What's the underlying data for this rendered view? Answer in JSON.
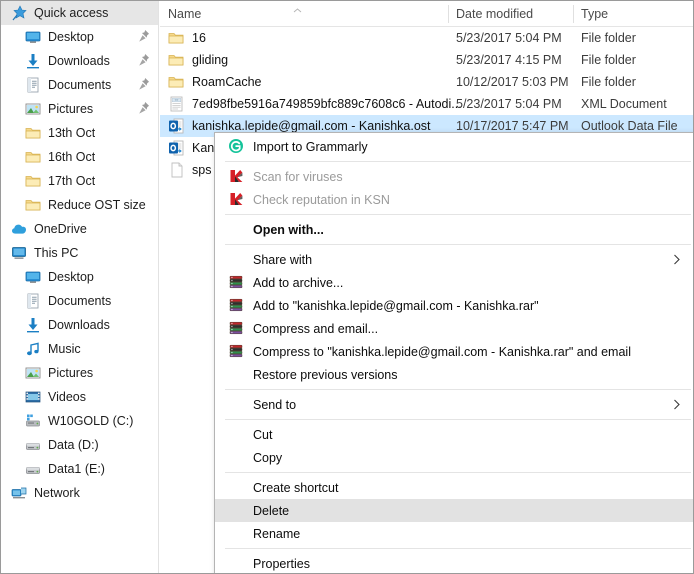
{
  "nav_pane": {
    "items": [
      {
        "label": "Quick access",
        "icon": "pin-star-icon",
        "level": 0,
        "selected": true,
        "pinned": false
      },
      {
        "label": "Desktop",
        "icon": "desktop-icon",
        "level": 1,
        "selected": false,
        "pinned": true
      },
      {
        "label": "Downloads",
        "icon": "downloads-icon",
        "level": 1,
        "selected": false,
        "pinned": true
      },
      {
        "label": "Documents",
        "icon": "documents-icon",
        "level": 1,
        "selected": false,
        "pinned": true
      },
      {
        "label": "Pictures",
        "icon": "pictures-icon",
        "level": 1,
        "selected": false,
        "pinned": true
      },
      {
        "label": "13th Oct",
        "icon": "folder-icon",
        "level": 1,
        "selected": false,
        "pinned": false
      },
      {
        "label": "16th Oct",
        "icon": "folder-icon",
        "level": 1,
        "selected": false,
        "pinned": false
      },
      {
        "label": "17th Oct",
        "icon": "folder-icon",
        "level": 1,
        "selected": false,
        "pinned": false
      },
      {
        "label": "Reduce OST size",
        "icon": "folder-icon",
        "level": 1,
        "selected": false,
        "pinned": false
      },
      {
        "label": "OneDrive",
        "icon": "onedrive-icon",
        "level": 0,
        "selected": false,
        "pinned": false
      },
      {
        "label": "This PC",
        "icon": "this-pc-icon",
        "level": 0,
        "selected": false,
        "pinned": false
      },
      {
        "label": "Desktop",
        "icon": "desktop-icon",
        "level": 1,
        "selected": false,
        "pinned": false
      },
      {
        "label": "Documents",
        "icon": "documents-icon",
        "level": 1,
        "selected": false,
        "pinned": false
      },
      {
        "label": "Downloads",
        "icon": "downloads-icon",
        "level": 1,
        "selected": false,
        "pinned": false
      },
      {
        "label": "Music",
        "icon": "music-icon",
        "level": 1,
        "selected": false,
        "pinned": false
      },
      {
        "label": "Pictures",
        "icon": "pictures-icon",
        "level": 1,
        "selected": false,
        "pinned": false
      },
      {
        "label": "Videos",
        "icon": "videos-icon",
        "level": 1,
        "selected": false,
        "pinned": false
      },
      {
        "label": "W10GOLD (C:)",
        "icon": "system-drive-icon",
        "level": 1,
        "selected": false,
        "pinned": false
      },
      {
        "label": "Data (D:)",
        "icon": "drive-icon",
        "level": 1,
        "selected": false,
        "pinned": false
      },
      {
        "label": "Data1 (E:)",
        "icon": "drive-icon",
        "level": 1,
        "selected": false,
        "pinned": false
      },
      {
        "label": "Network",
        "icon": "network-icon",
        "level": 0,
        "selected": false,
        "pinned": false
      }
    ]
  },
  "file_list": {
    "columns": [
      {
        "key": "name",
        "label": "Name",
        "sorted": true,
        "sort_direction": "ascending"
      },
      {
        "key": "date",
        "label": "Date modified",
        "sorted": false,
        "sort_direction": ""
      },
      {
        "key": "type",
        "label": "Type",
        "sorted": false,
        "sort_direction": ""
      }
    ],
    "rows": [
      {
        "name": "16",
        "date": "5/23/2017 5:04 PM",
        "type": "File folder",
        "icon": "folder-icon",
        "selected": false
      },
      {
        "name": "gliding",
        "date": "5/23/2017 4:15 PM",
        "type": "File folder",
        "icon": "folder-icon",
        "selected": false
      },
      {
        "name": "RoamCache",
        "date": "10/12/2017 5:03 PM",
        "type": "File folder",
        "icon": "folder-icon",
        "selected": false
      },
      {
        "name": "7ed98fbe5916a749859bfc889c7608c6 - Autodi...",
        "date": "5/23/2017 5:04 PM",
        "type": "XML Document",
        "icon": "xml-document-icon",
        "selected": false
      },
      {
        "name": "kanishka.lepide@gmail.com - Kanishka.ost",
        "date": "10/17/2017 5:47 PM",
        "type": "Outlook Data File",
        "icon": "outlook-data-file-icon",
        "selected": true
      },
      {
        "name": "Kan",
        "date": "",
        "type": "",
        "icon": "outlook-data-file-icon",
        "selected": false
      },
      {
        "name": "sps",
        "date": "",
        "type": "",
        "icon": "generic-file-icon",
        "selected": false
      }
    ]
  },
  "context_menu": {
    "items": [
      {
        "label": "Import to Grammarly",
        "icon": "grammarly-icon",
        "state": "normal",
        "submenu": false,
        "separator_after": true
      },
      {
        "label": "Scan for viruses",
        "icon": "kaspersky-icon",
        "state": "disabled",
        "submenu": false,
        "separator_after": false
      },
      {
        "label": "Check reputation in KSN",
        "icon": "kaspersky-icon",
        "state": "disabled",
        "submenu": false,
        "separator_after": true
      },
      {
        "label": "Open with...",
        "icon": "",
        "state": "bold",
        "submenu": false,
        "separator_after": true
      },
      {
        "label": "Share with",
        "icon": "",
        "state": "normal",
        "submenu": true,
        "separator_after": false
      },
      {
        "label": "Add to archive...",
        "icon": "winrar-icon",
        "state": "normal",
        "submenu": false,
        "separator_after": false
      },
      {
        "label": "Add to \"kanishka.lepide@gmail.com - Kanishka.rar\"",
        "icon": "winrar-icon",
        "state": "normal",
        "submenu": false,
        "separator_after": false
      },
      {
        "label": "Compress and email...",
        "icon": "winrar-icon",
        "state": "normal",
        "submenu": false,
        "separator_after": false
      },
      {
        "label": "Compress to \"kanishka.lepide@gmail.com - Kanishka.rar\" and email",
        "icon": "winrar-icon",
        "state": "normal",
        "submenu": false,
        "separator_after": false
      },
      {
        "label": "Restore previous versions",
        "icon": "",
        "state": "normal",
        "submenu": false,
        "separator_after": true
      },
      {
        "label": "Send to",
        "icon": "",
        "state": "normal",
        "submenu": true,
        "separator_after": true
      },
      {
        "label": "Cut",
        "icon": "",
        "state": "normal",
        "submenu": false,
        "separator_after": false
      },
      {
        "label": "Copy",
        "icon": "",
        "state": "normal",
        "submenu": false,
        "separator_after": true
      },
      {
        "label": "Create shortcut",
        "icon": "",
        "state": "normal",
        "submenu": false,
        "separator_after": false
      },
      {
        "label": "Delete",
        "icon": "",
        "state": "highlight",
        "submenu": false,
        "separator_after": false
      },
      {
        "label": "Rename",
        "icon": "",
        "state": "normal",
        "submenu": false,
        "separator_after": true
      },
      {
        "label": "Properties",
        "icon": "",
        "state": "normal",
        "submenu": false,
        "separator_after": false
      }
    ]
  },
  "colors": {
    "selection_blue": "#cce8ff",
    "menu_highlight": "#e2e2e2",
    "nav_selected": "#e6e6e6",
    "folder_yellow": "#fbe7a8",
    "accent_blue": "#0078d7",
    "grammarly_green": "#15c39a",
    "kaspersky_red": "#d62027"
  }
}
